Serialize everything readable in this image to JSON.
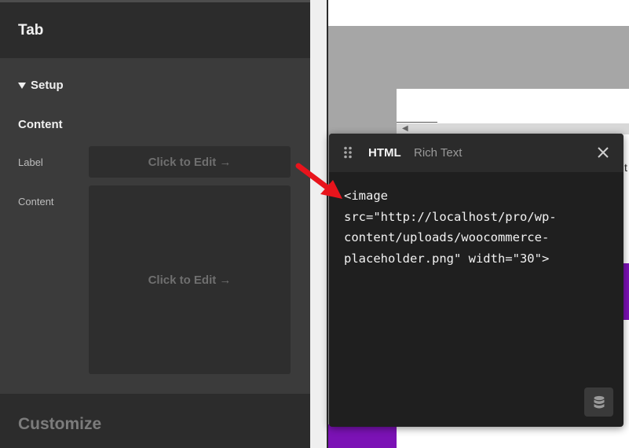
{
  "panel": {
    "title": "Tab",
    "section": "Setup",
    "group": "Content",
    "fields": [
      {
        "label": "Label",
        "placeholder": "Click to Edit →"
      },
      {
        "label": "Content",
        "placeholder": "Click to Edit →"
      }
    ],
    "customize": "Customize"
  },
  "editor": {
    "tabs": [
      {
        "label": "HTML",
        "active": true
      },
      {
        "label": "Rich Text",
        "active": false
      }
    ],
    "code_lines": [
      "<image",
      "src=\"http://localhost/pro/wp-",
      "content/uploads/woocommerce-",
      "placeholder.png\" width=\"30\">"
    ]
  },
  "canvas": {
    "edge_char": "t"
  },
  "icons": {
    "drag": "drag-handle-icon",
    "close": "close-icon",
    "dynamic": "database-icon",
    "collapse": "triangle-down-icon",
    "annotation": "red-arrow-icon"
  },
  "colors": {
    "panel_bg": "#3b3b3b",
    "header_bg": "#2c2c2c",
    "editor_bg": "#1f1f1f",
    "accent_purple": "#7b12b5",
    "arrow_red": "#e8141c"
  }
}
